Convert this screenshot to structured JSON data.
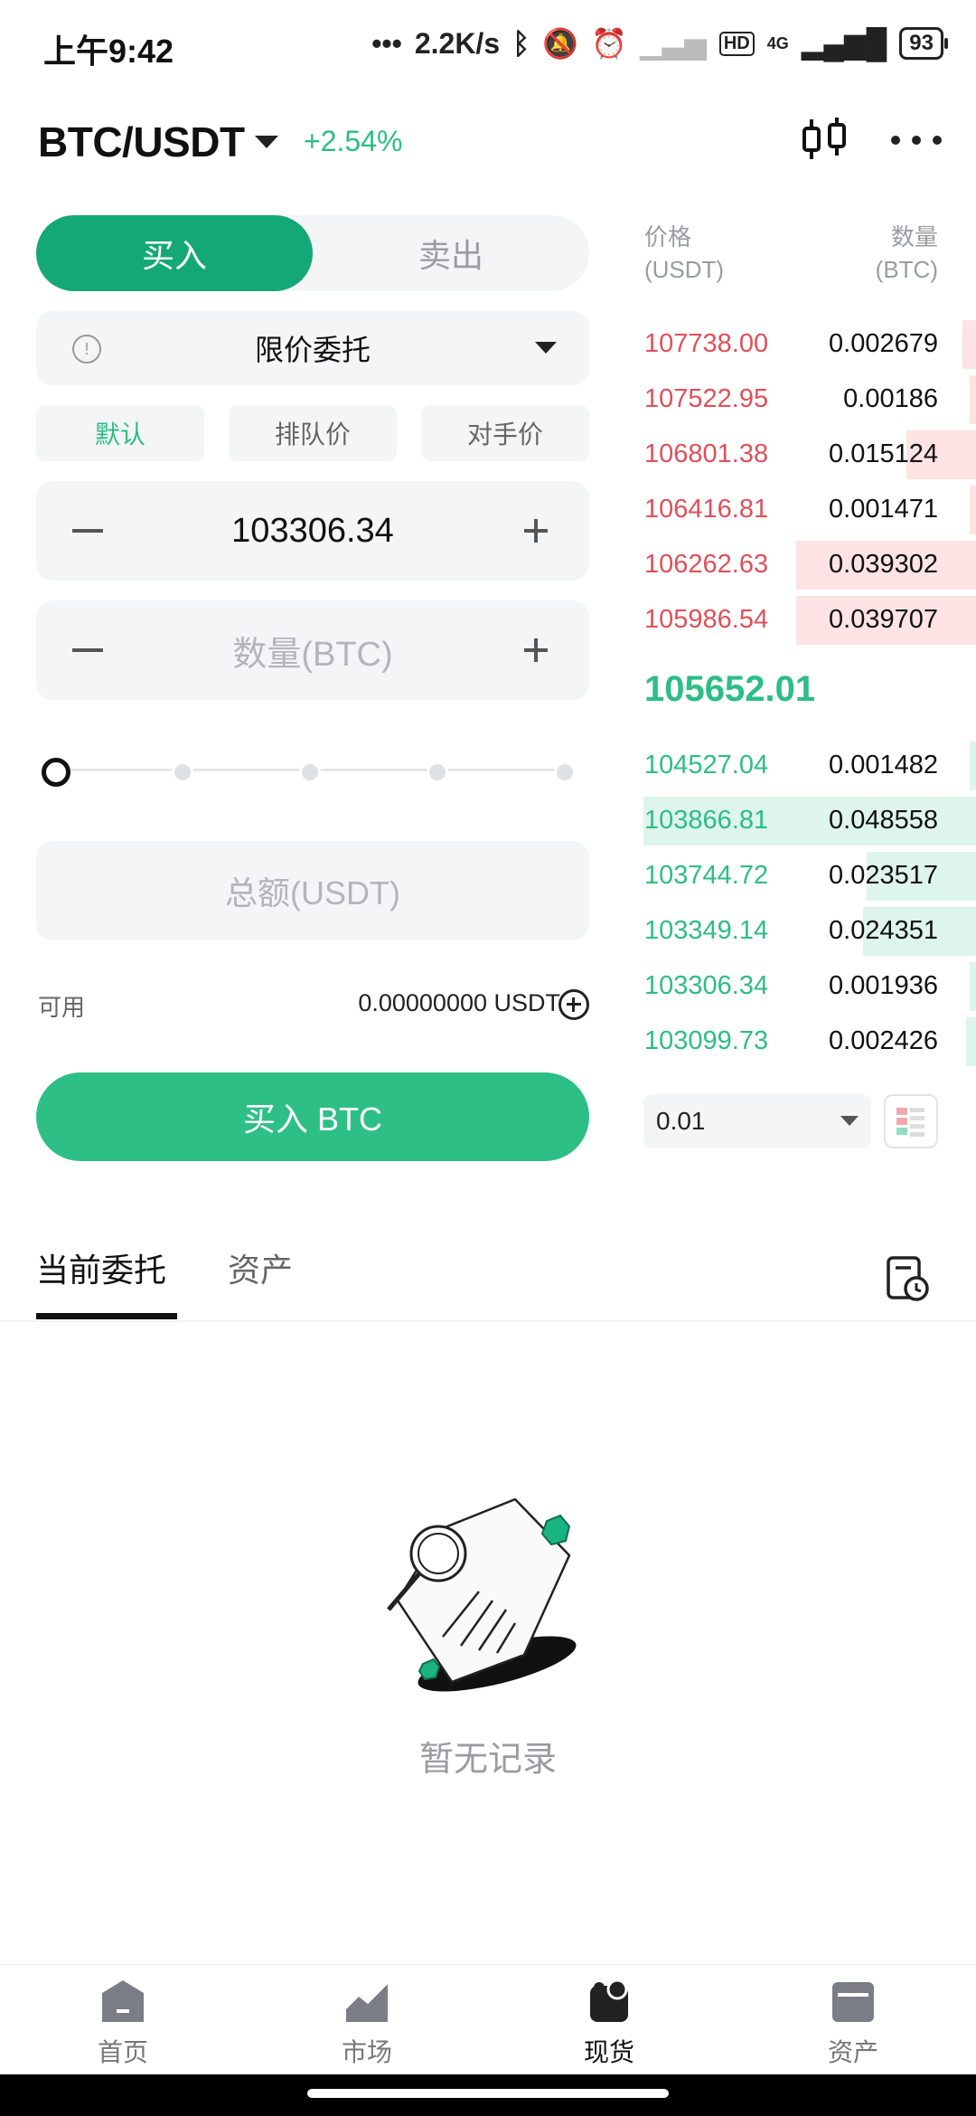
{
  "status_bar": {
    "time": "上午9:42",
    "net_speed": "2.2K/s",
    "network": "4G",
    "battery": "93"
  },
  "header": {
    "pair": "BTC/USDT",
    "change": "+2.54%"
  },
  "trade": {
    "buy_tab": "买入",
    "sell_tab": "卖出",
    "order_type": "限价委托",
    "price_modes": [
      "默认",
      "排队价",
      "对手价"
    ],
    "price_value": "103306.34",
    "amount_placeholder": "数量(BTC)",
    "slider_percent": 0,
    "total_placeholder": "总额(USDT)",
    "available_label": "可用",
    "available_value": "0.00000000 USDT",
    "buy_button": "买入 BTC"
  },
  "order_book": {
    "price_header": "价格",
    "price_unit": "(USDT)",
    "qty_header": "数量",
    "qty_unit": "(BTC)",
    "asks": [
      {
        "price": "107738.00",
        "qty": "0.002679",
        "depth": 0.04
      },
      {
        "price": "107522.95",
        "qty": "0.00186",
        "depth": 0.02
      },
      {
        "price": "106801.38",
        "qty": "0.015124",
        "depth": 0.21
      },
      {
        "price": "106416.81",
        "qty": "0.001471",
        "depth": 0.02
      },
      {
        "price": "106262.63",
        "qty": "0.039302",
        "depth": 0.54
      },
      {
        "price": "105986.54",
        "qty": "0.039707",
        "depth": 0.54
      }
    ],
    "mid_price": "105652.01",
    "bids": [
      {
        "price": "104527.04",
        "qty": "0.001482",
        "depth": 0.02
      },
      {
        "price": "103866.81",
        "qty": "0.048558",
        "depth": 1.0
      },
      {
        "price": "103744.72",
        "qty": "0.023517",
        "depth": 0.33
      },
      {
        "price": "103349.14",
        "qty": "0.024351",
        "depth": 0.34
      },
      {
        "price": "103306.34",
        "qty": "0.001936",
        "depth": 0.02
      },
      {
        "price": "103099.73",
        "qty": "0.002426",
        "depth": 0.03
      }
    ],
    "depth_step": "0.01"
  },
  "tabs": {
    "current_orders": "当前委托",
    "assets": "资产"
  },
  "empty": {
    "text": "暂无记录"
  },
  "bottom_nav": [
    {
      "label": "首页",
      "icon": "home-icon"
    },
    {
      "label": "市场",
      "icon": "market-chart-icon"
    },
    {
      "label": "现货",
      "icon": "spot-icon"
    },
    {
      "label": "资产",
      "icon": "wallet-icon"
    }
  ],
  "colors": {
    "buy_green": "#15a877",
    "up_green": "#2dbd85",
    "down_red": "#e0505a"
  }
}
